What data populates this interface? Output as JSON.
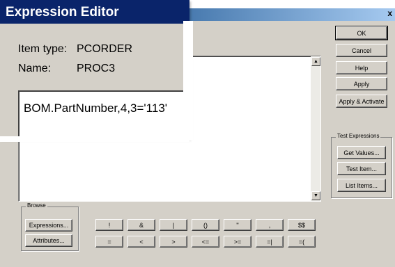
{
  "window": {
    "close_glyph": "x"
  },
  "dialog": {
    "title": "Expression Editor"
  },
  "item": {
    "type_label": "Item type:",
    "type_value": "PCORDER",
    "name_label": "Name:",
    "name_value": "PROC3"
  },
  "expression": {
    "text": "BOM.PartNumber,4,3='113'"
  },
  "scroll": {
    "up": "▲",
    "down": "▼"
  },
  "right_buttons": {
    "ok": "OK",
    "cancel": "Cancel",
    "help": "Help",
    "apply": "Apply",
    "apply_activate": "Apply & Activate"
  },
  "test_group": {
    "title": "Test Expressions",
    "get_values": "Get Values...",
    "test_item": "Test Item...",
    "list_items": "List Items..."
  },
  "browse_group": {
    "title": "Browse",
    "expressions": "Expressions...",
    "attributes": "Attributes..."
  },
  "operators_row1": [
    "!",
    "&",
    "|",
    "()",
    "''",
    ",",
    "$$"
  ],
  "operators_row2": [
    "=",
    "<",
    ">",
    "<=",
    ">=",
    "=|",
    "=("
  ],
  "colors": {
    "title_left": "#0a246a",
    "title_right": "#a6caf0",
    "dialog_bg": "#d4d0c8"
  }
}
